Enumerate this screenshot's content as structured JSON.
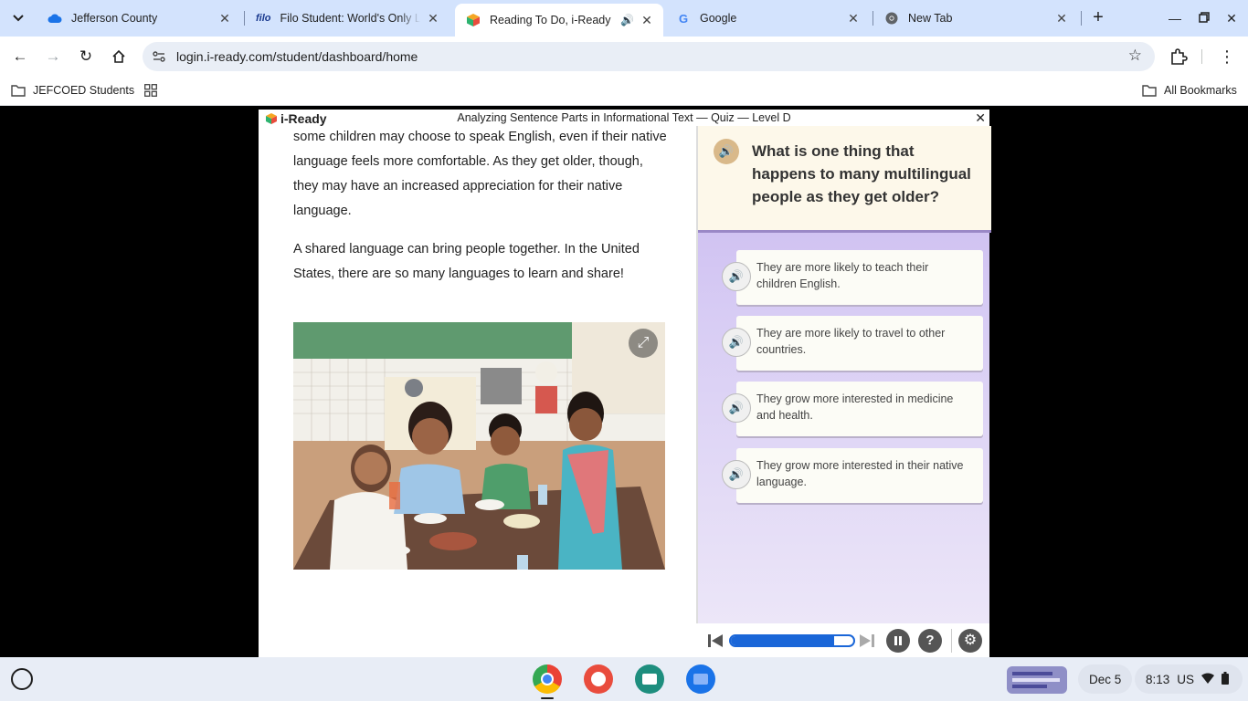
{
  "browser": {
    "tabs": [
      {
        "title": "Jefferson County",
        "icon": "cloud-icon",
        "active": false
      },
      {
        "title": "Filo Student: World's Only Live",
        "icon": "filo-logo",
        "active": false
      },
      {
        "title": "Reading To Do, i-Ready",
        "icon": "iready-cube-icon",
        "active": true,
        "audio": true
      },
      {
        "title": "Google",
        "icon": "google-icon",
        "active": false
      },
      {
        "title": "New Tab",
        "icon": "chrome-icon",
        "active": false
      }
    ],
    "filo_favicon_text": "filo",
    "url": "login.i-ready.com/student/dashboard/home",
    "bookmarks": {
      "folder": "JEFCOED Students",
      "all_bookmarks": "All Bookmarks"
    }
  },
  "app": {
    "logo_text": "i-Ready",
    "quiz_title": "Analyzing Sentence Parts in Informational Text — Quiz — Level D",
    "passage": [
      "some children may choose to speak English, even if their native language feels more comfortable. As they get older, though, they may have an increased appreciation for their native language.",
      "A shared language can bring people together. In the United States, there are so many languages to learn and share!"
    ],
    "question": "What is one thing that happens to many multilingual people as they get older?",
    "answers": [
      {
        "text": "They are more likely to teach their children English."
      },
      {
        "text": "They are more likely to travel to other countries."
      },
      {
        "text": "They grow more interested in medicine and health."
      },
      {
        "text": "They grow more interested in their native language."
      }
    ],
    "audio_progress": 0.84
  },
  "shelf": {
    "date": "Dec 5",
    "time": "8:13",
    "locale": "US"
  },
  "colors": {
    "accent_blue": "#1a66d8",
    "question_bg": "#fdf8ea",
    "answer_panel": "#c8b7f0"
  }
}
